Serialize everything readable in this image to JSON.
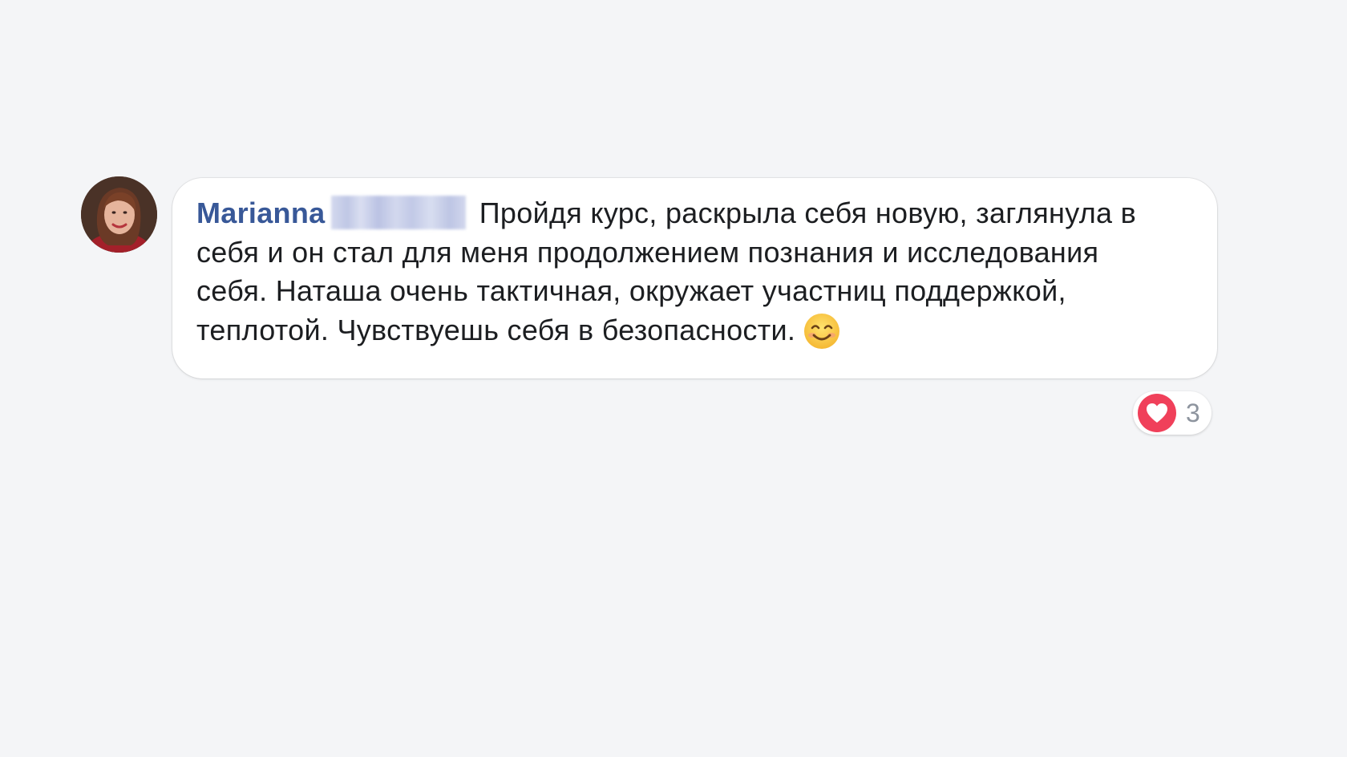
{
  "comment": {
    "author": "Marianna",
    "text": "Пройдя курс, раскрыла себя новую, заглянула в себя и он стал для меня продолжением познания и исследования себя. Наташа очень тактичная, окружает участниц поддержкой, теплотой. Чувствуешь себя в безопасности.",
    "emoji": "smiling-face-icon",
    "reactions": {
      "icon": "heart-icon",
      "count": "3",
      "color": "#f0405a"
    }
  },
  "colors": {
    "background": "#f4f5f7",
    "author_link": "#385898",
    "text": "#1c1e21"
  }
}
